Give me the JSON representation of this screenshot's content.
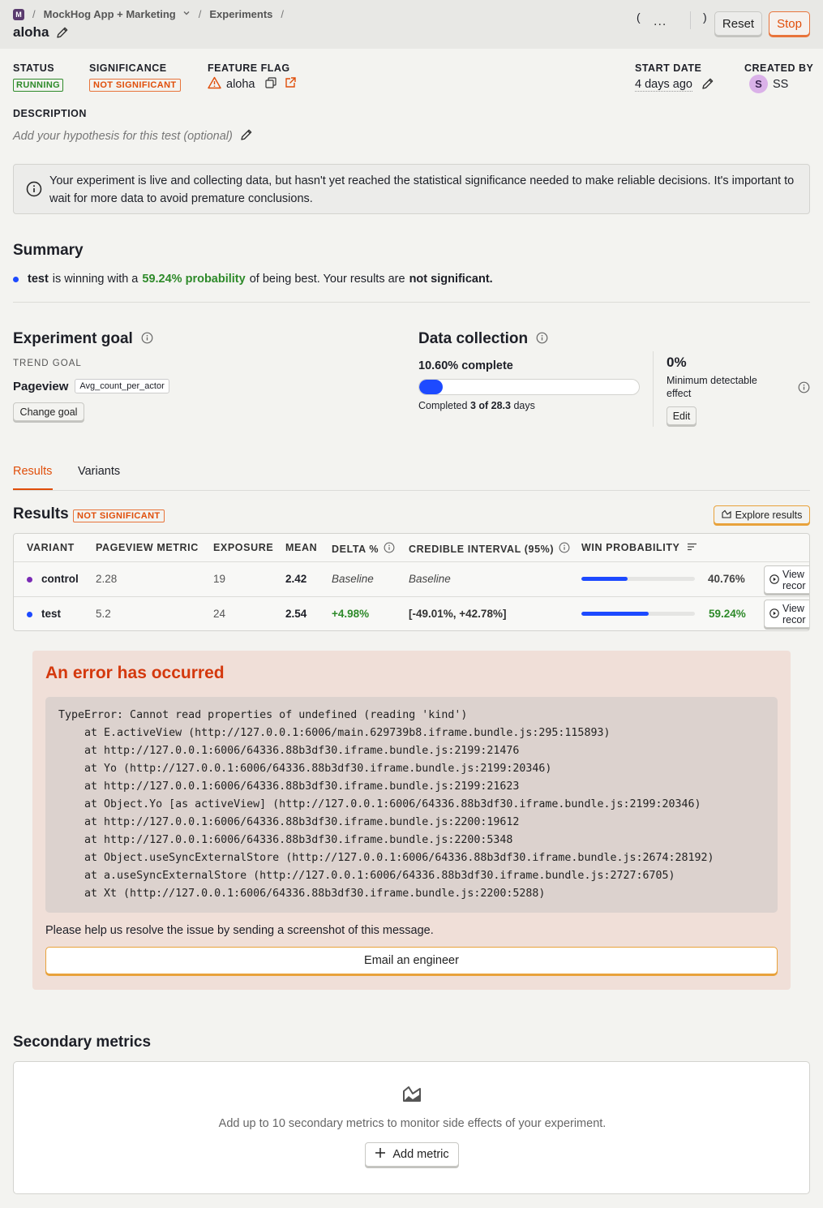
{
  "header": {
    "project_initial": "M",
    "project_name": "MockHog App + Marketing",
    "section": "Experiments",
    "title": "aloha",
    "paren_open": "(",
    "paren_close": ")",
    "more": "...",
    "reset_label": "Reset",
    "stop_label": "Stop"
  },
  "meta": {
    "status_label": "STATUS",
    "status_value": "RUNNING",
    "significance_label": "SIGNIFICANCE",
    "significance_value": "NOT SIGNIFICANT",
    "flag_label": "FEATURE FLAG",
    "flag_value": "aloha",
    "start_label": "START DATE",
    "start_value": "4 days ago",
    "created_label": "CREATED BY",
    "created_initial": "S",
    "created_value": "SS",
    "description_label": "DESCRIPTION",
    "description_placeholder": "Add your hypothesis for this test (optional)"
  },
  "info_banner": "Your experiment is live and collecting data, but hasn't yet reached the statistical significance needed to make reliable decisions. It's important to wait for more data to avoid premature conclusions.",
  "summary": {
    "heading": "Summary",
    "variant": "test",
    "text1": "is winning with a",
    "probability": "59.24% probability",
    "text2": "of being best. Your results are",
    "verdict": "not significant."
  },
  "goal": {
    "heading": "Experiment goal",
    "type_label": "TREND GOAL",
    "event": "Pageview",
    "math": "Avg_count_per_actor",
    "change_label": "Change goal"
  },
  "collection": {
    "heading": "Data collection",
    "complete": "10.60% complete",
    "progress": 0.106,
    "completed_prefix": "Completed",
    "completed_value": "3 of 28.3",
    "completed_suffix": "days",
    "mde_value": "0%",
    "mde_label": "Minimum detectable effect",
    "edit_label": "Edit"
  },
  "tabs": [
    {
      "label": "Results",
      "active": true
    },
    {
      "label": "Variants",
      "active": false
    }
  ],
  "results": {
    "heading": "Results",
    "badge": "NOT SIGNIFICANT",
    "explore_label": "Explore results",
    "columns": [
      "VARIANT",
      "PAGEVIEW METRIC",
      "EXPOSURE",
      "MEAN",
      "DELTA %",
      "CREDIBLE INTERVAL (95%)",
      "WIN PROBABILITY"
    ],
    "rows": [
      {
        "variant": "control",
        "metric": "2.28",
        "exposure": "19",
        "mean": "2.42",
        "delta": "Baseline",
        "interval": "Baseline",
        "win": "40.76%",
        "win_value": 0.4076,
        "dot": "#7a2bb5",
        "view": "View recor"
      },
      {
        "variant": "test",
        "metric": "5.2",
        "exposure": "24",
        "mean": "2.54",
        "delta": "+4.98%",
        "interval": "[-49.01%, +42.78%]",
        "win": "59.24%",
        "win_value": 0.5924,
        "dot": "#1d4aff",
        "view": "View recor"
      }
    ]
  },
  "error": {
    "heading": "An error has occurred",
    "trace": "TypeError: Cannot read properties of undefined (reading 'kind')\n    at E.activeView (http://127.0.0.1:6006/main.629739b8.iframe.bundle.js:295:115893)\n    at http://127.0.0.1:6006/64336.88b3df30.iframe.bundle.js:2199:21476\n    at Yo (http://127.0.0.1:6006/64336.88b3df30.iframe.bundle.js:2199:20346)\n    at http://127.0.0.1:6006/64336.88b3df30.iframe.bundle.js:2199:21623\n    at Object.Yo [as activeView] (http://127.0.0.1:6006/64336.88b3df30.iframe.bundle.js:2199:20346)\n    at http://127.0.0.1:6006/64336.88b3df30.iframe.bundle.js:2200:19612\n    at http://127.0.0.1:6006/64336.88b3df30.iframe.bundle.js:2200:5348\n    at Object.useSyncExternalStore (http://127.0.0.1:6006/64336.88b3df30.iframe.bundle.js:2674:28192)\n    at a.useSyncExternalStore (http://127.0.0.1:6006/64336.88b3df30.iframe.bundle.js:2727:6705)\n    at Xt (http://127.0.0.1:6006/64336.88b3df30.iframe.bundle.js:2200:5288)",
    "help": "Please help us resolve the issue by sending a screenshot of this message.",
    "email_label": "Email an engineer"
  },
  "secondary": {
    "heading": "Secondary metrics",
    "empty_text": "Add up to 10 secondary metrics to monitor side effects of your experiment.",
    "add_label": "Add metric"
  },
  "colors": {
    "accent": "#e04e0a",
    "success": "#2e8a2a",
    "primary": "#1d4aff"
  }
}
